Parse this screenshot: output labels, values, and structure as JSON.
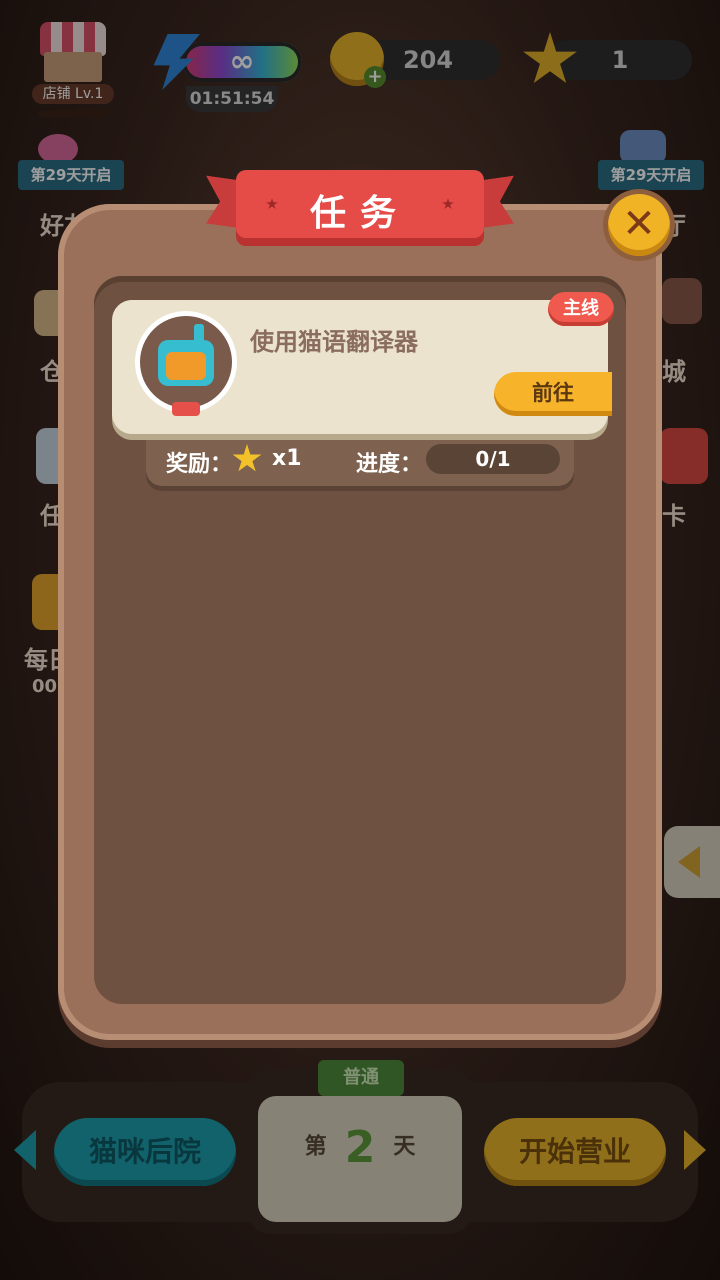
{
  "top_bar": {
    "shop_label": "店铺 Lv.1",
    "shop_progress": 0,
    "energy_value": "∞",
    "energy_timer": "01:51:54",
    "coins": "204",
    "stars": "1"
  },
  "side": {
    "left_badge": "第29天开启",
    "right_badge": "第29天开启",
    "left_labels": [
      "好友",
      "仓",
      "任",
      "每日",
      "00"
    ],
    "right_labels": [
      "厅",
      "城",
      "卡"
    ]
  },
  "modal": {
    "title": "任务",
    "close_label": "✕"
  },
  "task": {
    "name": "使用猫语翻译器",
    "type_tag": "主线",
    "go_label": "前往",
    "reward_label": "奖励：",
    "reward_count": "x1",
    "progress_label": "进度：",
    "progress_text": "0/1",
    "progress_current": 0,
    "progress_total": 1
  },
  "bottom": {
    "left_button": "猫咪后院",
    "right_button": "开始营业",
    "mode_badge": "普通",
    "day_prefix": "第",
    "day_number": "2",
    "day_suffix": "天"
  },
  "colors": {
    "accent_gold": "#f7b42a",
    "ribbon_red": "#e54b47",
    "panel_brown": "#6e5140"
  }
}
